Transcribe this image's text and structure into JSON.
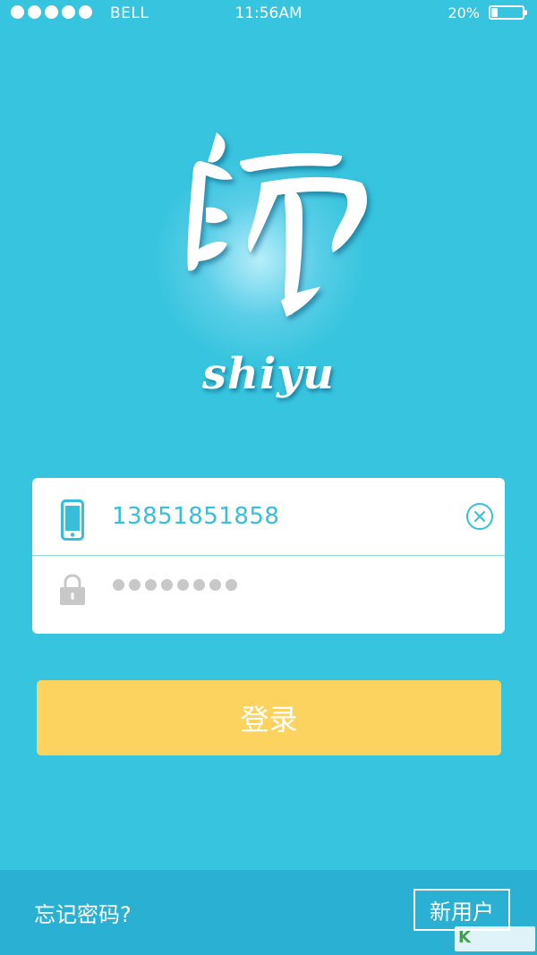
{
  "status_bar": {
    "carrier": "BELL",
    "time": "11:56AM",
    "battery_percent_label": "20%",
    "battery_level": 0.2,
    "signal_bars": 5
  },
  "logo": {
    "wordmark": "shiyu",
    "icon": "shi-calligraphy-logo-icon"
  },
  "login_form": {
    "phone_value": "13851851858",
    "phone_icon": "phone-icon",
    "clear_icon": "clear-circle-icon",
    "password_mask_length": 8,
    "lock_icon": "lock-icon"
  },
  "buttons": {
    "login_label": "登录",
    "forgot_password_label": "忘记密码?",
    "new_user_label": "新用户"
  },
  "colors": {
    "background": "#37c4de",
    "accent_button": "#fdd35f",
    "footer_bar": "#2ab0d2",
    "input_text": "#37bedb"
  }
}
